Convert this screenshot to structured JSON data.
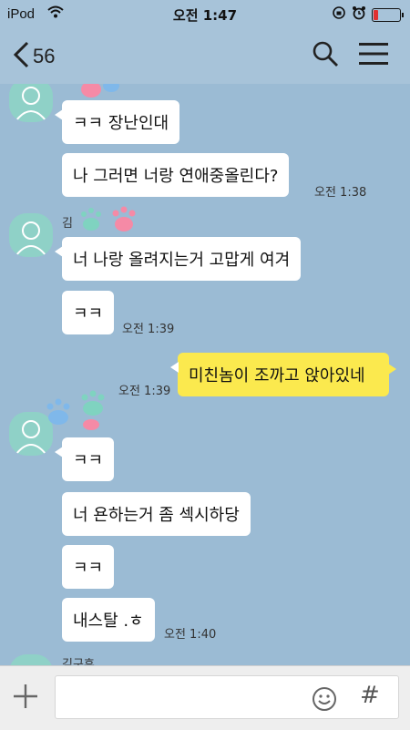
{
  "status_bar": {
    "carrier": "iPod",
    "time": "오전 1:47"
  },
  "header": {
    "back_count": "56"
  },
  "messages": [
    {
      "text": "ㅋㅋ 장난인대"
    },
    {
      "text": "나 그러면 너랑 연애중올린다?",
      "time": "오전 1:38"
    },
    {
      "sender_name": "김",
      "text": "너 나랑 올려지는거 고맙게 여겨"
    },
    {
      "text": "ㅋㅋ",
      "time": "오전 1:39"
    },
    {
      "text": "미친놈이 조까고 앉아있네",
      "time": "오전 1:39",
      "mine": true
    },
    {
      "text": "ㅋㅋ"
    },
    {
      "text": "너 욘하는거 좀 섹시하당"
    },
    {
      "text": "ㅋㅋ"
    },
    {
      "text": "내스탈 .ㅎ",
      "time": "오전 1:40"
    },
    {
      "sender_name": "김구휴"
    }
  ],
  "input_bar": {
    "hash_label": "#"
  },
  "icons": {
    "back": "chevron-left-icon",
    "search": "search-icon",
    "menu": "menu-icon",
    "plus": "plus-icon",
    "emoji": "smiley-icon",
    "avatar": "person-icon",
    "sticker": "paw-sticker"
  },
  "colors": {
    "background": "#9bbbd4",
    "my_bubble": "#fbe94e",
    "other_bubble": "#ffffff",
    "avatar": "#8fd1c7"
  }
}
